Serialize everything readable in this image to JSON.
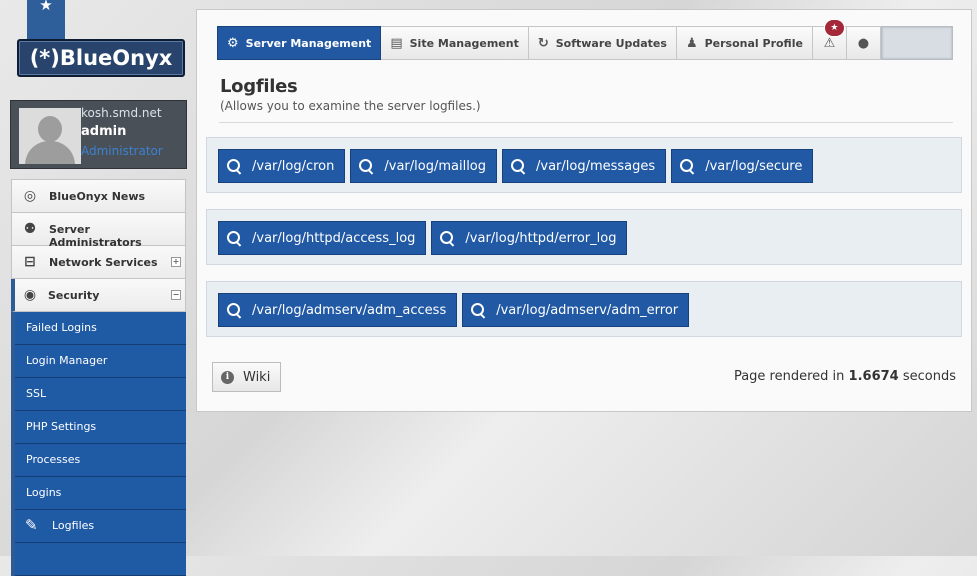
{
  "brand": {
    "logo_text": "(*)BlueOnyx"
  },
  "user": {
    "host": "kosh.smd.net",
    "name": "admin",
    "role": "Administrator"
  },
  "nav": {
    "items": [
      {
        "label": "BlueOnyx News",
        "icon": "news-icon"
      },
      {
        "label": "Server Administrators",
        "icon": "users-icon"
      },
      {
        "label": "Network Services",
        "icon": "network-icon",
        "toggle": "+"
      },
      {
        "label": "Security",
        "icon": "eye-icon",
        "toggle": "−"
      }
    ],
    "security_sub": [
      "Failed Logins",
      "Login Manager",
      "SSL",
      "PHP Settings",
      "Processes",
      "Logins",
      "Logfiles"
    ]
  },
  "tabs": [
    {
      "label": "Server Management",
      "icon": "gear-icon",
      "active": true
    },
    {
      "label": "Site Management",
      "icon": "sites-icon"
    },
    {
      "label": "Software Updates",
      "icon": "refresh-icon"
    },
    {
      "label": "Personal Profile",
      "icon": "person-icon"
    }
  ],
  "alerts": {
    "badge": "★"
  },
  "page": {
    "title": "Logfiles",
    "subtitle": "(Allows you to examine the server logfiles.)"
  },
  "log_groups": [
    [
      "/var/log/cron",
      "/var/log/maillog",
      "/var/log/messages",
      "/var/log/secure"
    ],
    [
      "/var/log/httpd/access_log",
      "/var/log/httpd/error_log"
    ],
    [
      "/var/log/admserv/adm_access",
      "/var/log/admserv/adm_error"
    ]
  ],
  "footer": {
    "wiki_label": "Wiki",
    "render_prefix": "Page rendered in",
    "render_time": "1.6674",
    "render_suffix": "seconds"
  },
  "colors": {
    "accent": "#2258a2",
    "badge": "#a4283a"
  }
}
